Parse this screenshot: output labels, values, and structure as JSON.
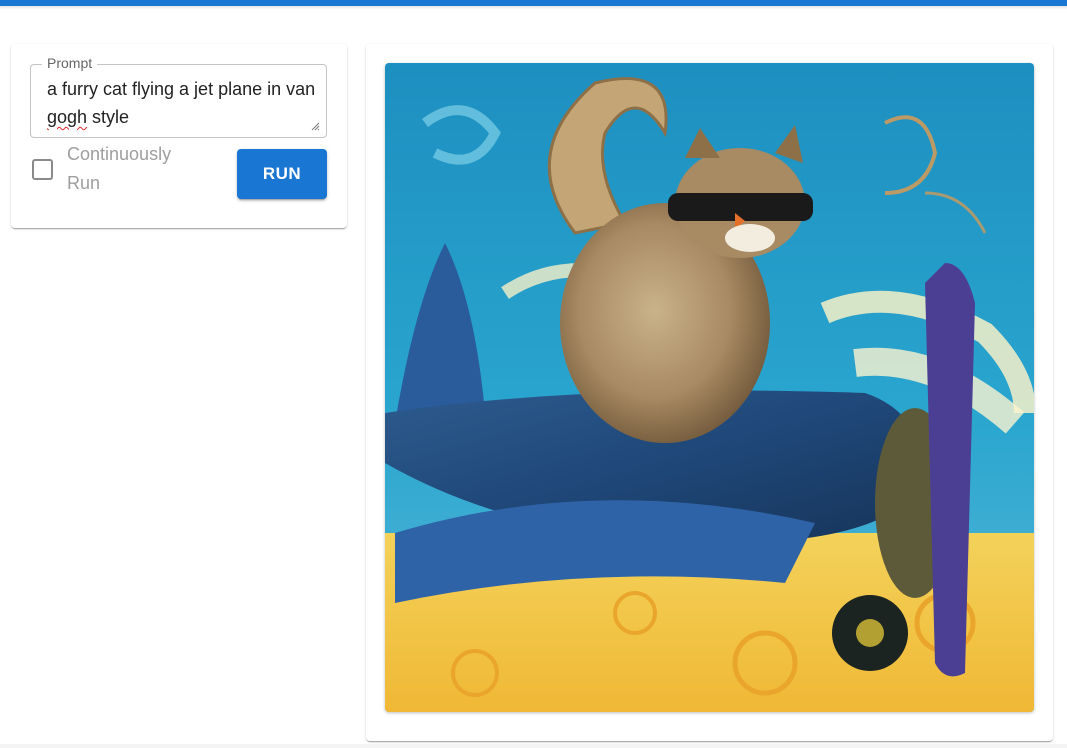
{
  "prompt": {
    "label": "Prompt",
    "value_part1": "a furry cat flying a jet plane in van ",
    "value_misspelled": "gogh",
    "value_part2": " style"
  },
  "options": {
    "continuous_label": "Continuously Run",
    "continuous_checked": false
  },
  "actions": {
    "run_label": "RUN"
  },
  "output": {
    "image_description_icon": "generated-image",
    "accent": "#1976d2"
  }
}
